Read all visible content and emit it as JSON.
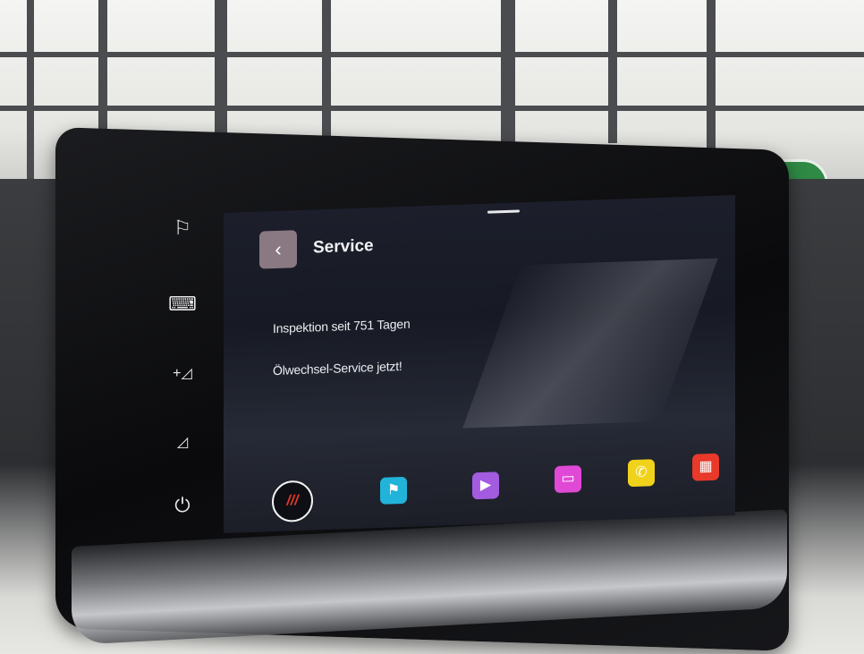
{
  "screen": {
    "header": {
      "back_icon": "chevron-left",
      "title": "Service"
    },
    "messages": [
      {
        "text": "Inspektion seit 751 Tagen"
      },
      {
        "text": "Ölwechsel-Service jetzt!"
      }
    ]
  },
  "side_buttons": [
    {
      "icon": "flag-icon",
      "glyph": "⚐"
    },
    {
      "icon": "keyboard-icon",
      "glyph": "⌨"
    },
    {
      "icon": "volume-up-icon",
      "glyph": "+◿"
    },
    {
      "icon": "volume-down-icon",
      "glyph": "◿"
    },
    {
      "icon": "power-icon",
      "glyph": "⏻"
    }
  ],
  "dock": {
    "home_label": "///",
    "apps": [
      {
        "icon": "navigation-flag-icon",
        "color": "#22b3d9",
        "glyph": "⚑"
      },
      {
        "icon": "media-play-icon",
        "color": "#a35be0",
        "glyph": "▶"
      },
      {
        "icon": "radio-icon",
        "color": "#e049d6",
        "glyph": "▭"
      },
      {
        "icon": "phone-icon",
        "color": "#f0d21a",
        "glyph": "✆"
      },
      {
        "icon": "car-settings-icon",
        "color": "#e8392a",
        "glyph": "▦"
      }
    ]
  }
}
